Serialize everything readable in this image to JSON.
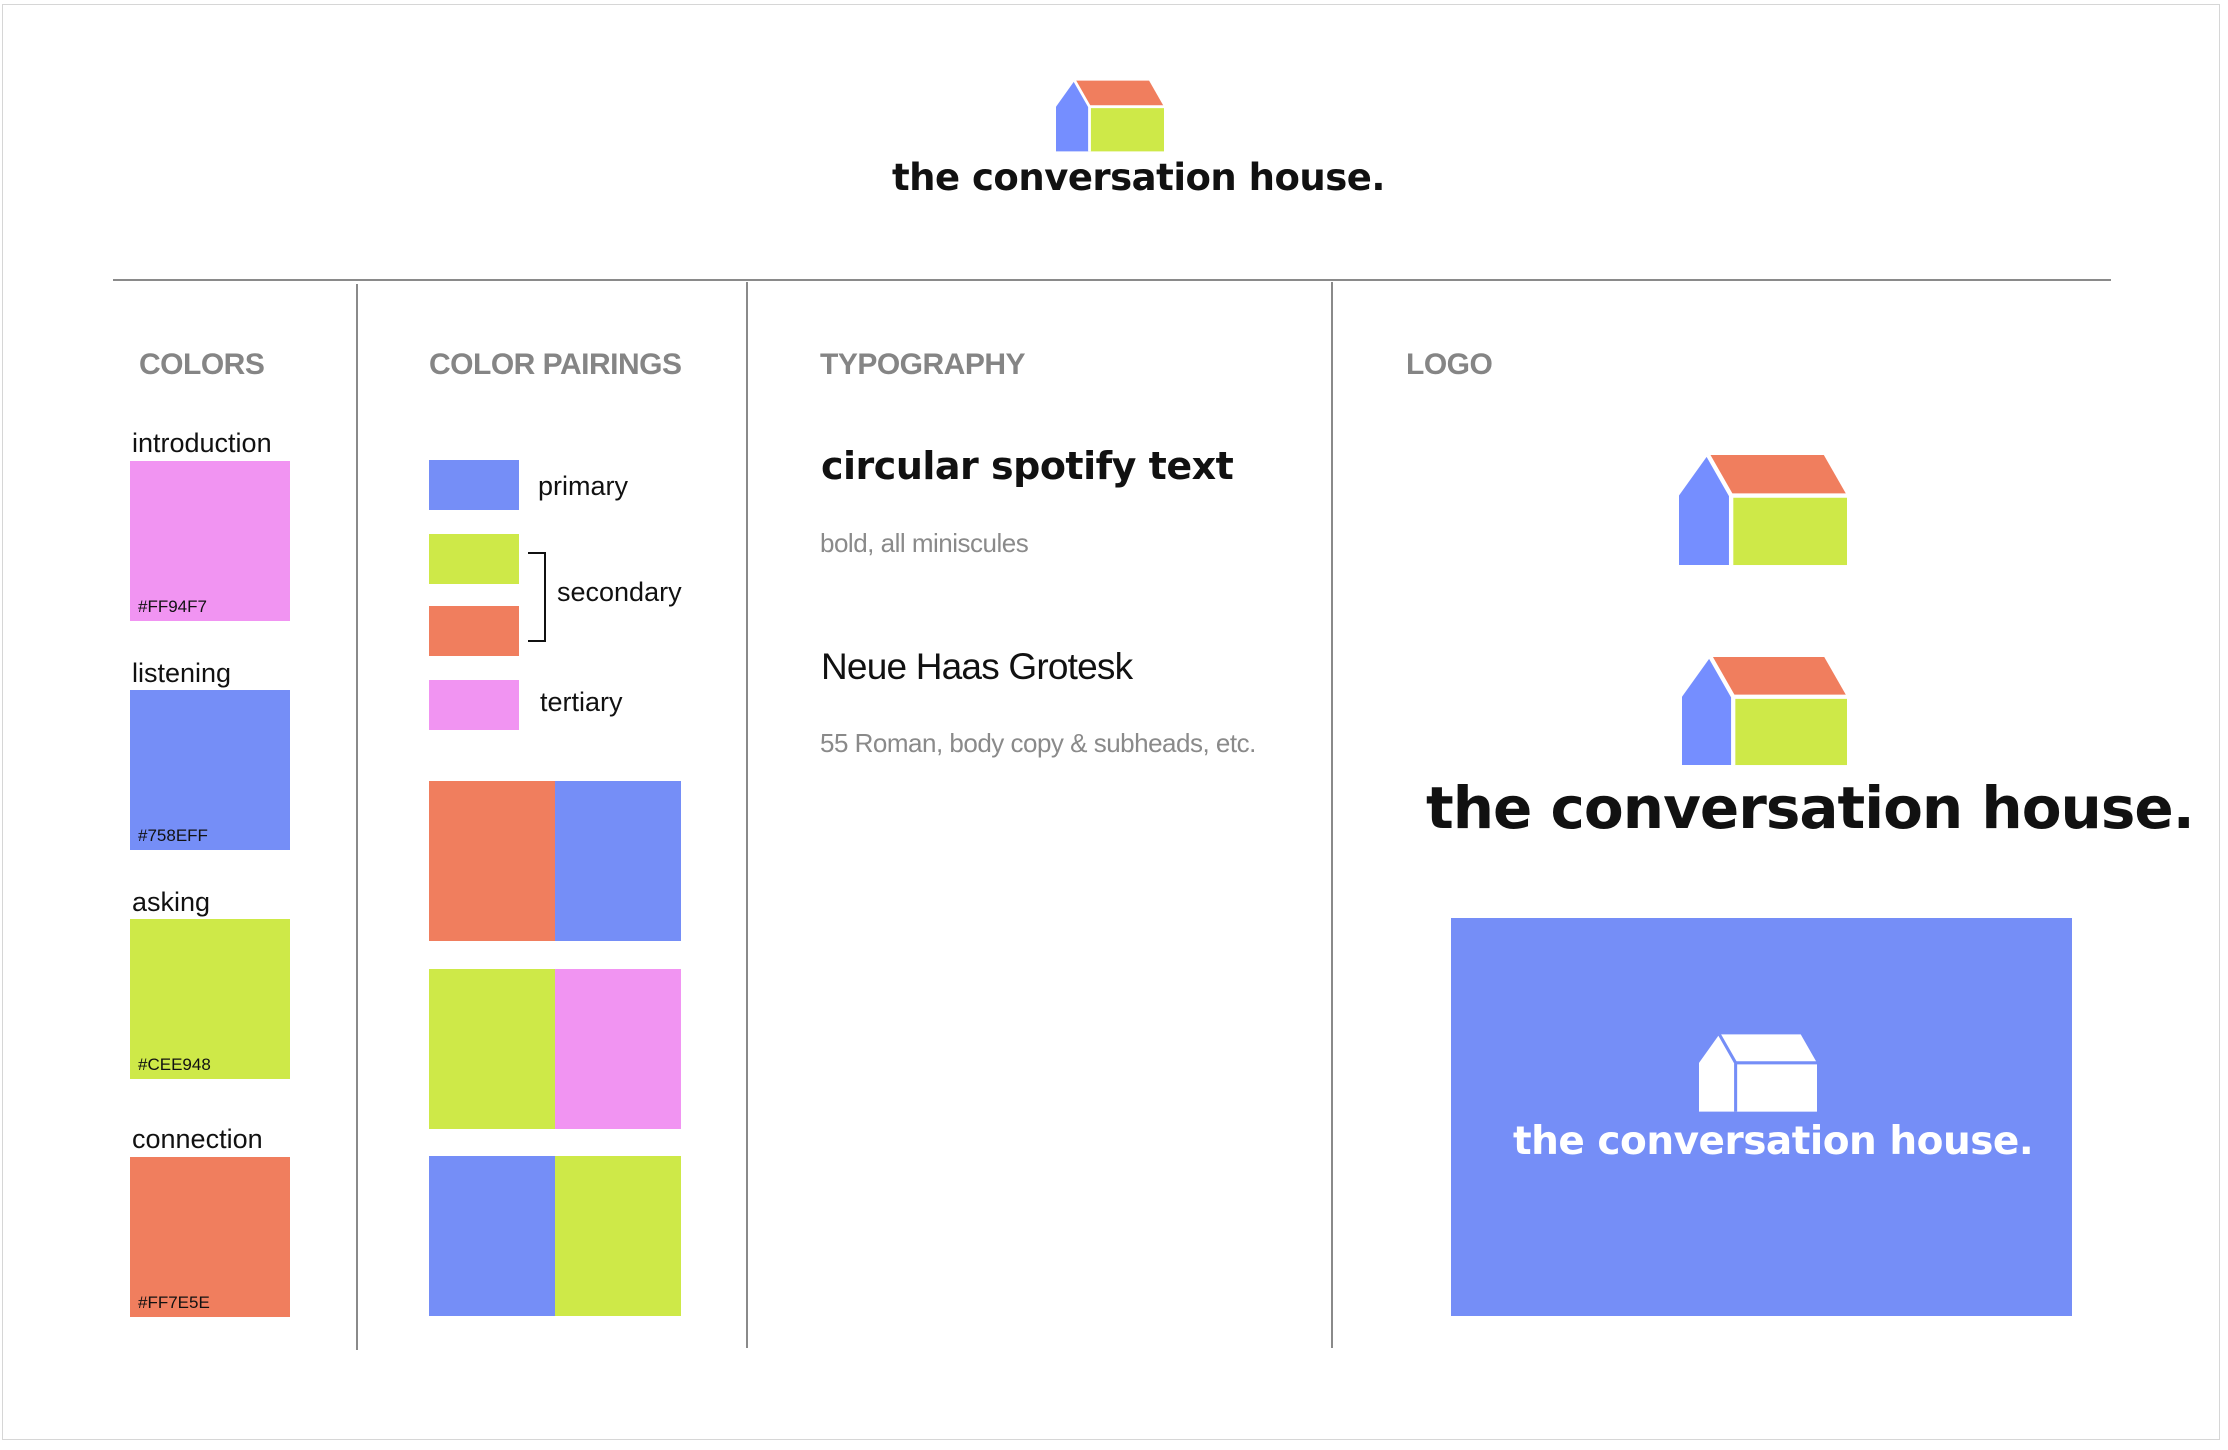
{
  "brand": {
    "name": "the conversation house."
  },
  "colors": {
    "blue": "#758EFF",
    "green": "#CEE948",
    "pink": "#FF94F7",
    "orange": "#FF7E5E",
    "orange_display": "#F07E5E",
    "heading_gray": "#858585"
  },
  "sections": {
    "colors": {
      "heading": "COLORS",
      "swatches": [
        {
          "label": "introduction",
          "hex": "#FF94F7"
        },
        {
          "label": "listening",
          "hex": "#758EFF"
        },
        {
          "label": "asking",
          "hex": "#CEE948"
        },
        {
          "label": "connection",
          "hex": "#FF7E5E"
        }
      ]
    },
    "pairings": {
      "heading": "COLOR PAIRINGS",
      "legend": {
        "primary": "primary",
        "secondary": "secondary",
        "tertiary": "tertiary"
      }
    },
    "typography": {
      "heading": "TYPOGRAPHY",
      "fonts": [
        {
          "name": "circular spotify text",
          "note": "bold, all miniscules"
        },
        {
          "name": "Neue Haas Grotesk",
          "note": "55 Roman, body copy & subheads, etc."
        }
      ]
    },
    "logo": {
      "heading": "LOGO"
    }
  },
  "icons": [
    "house-logo-icon"
  ]
}
